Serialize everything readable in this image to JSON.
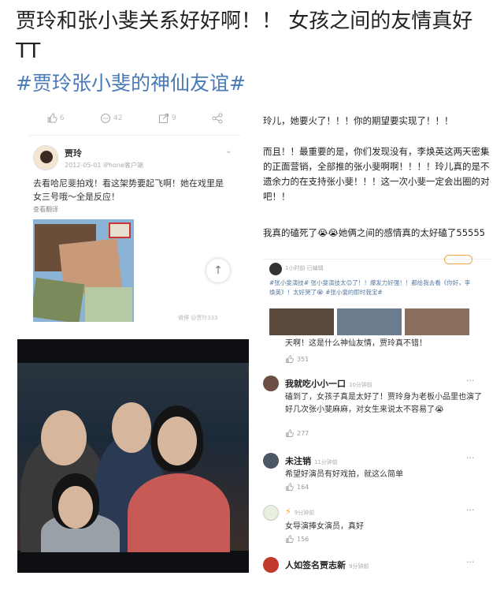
{
  "headline": "贾玲和张小斐关系好好啊！！ 女孩之间的友情真好TT",
  "hashtag": "#贾玲张小斐的神仙友谊#",
  "post": {
    "actions": [
      {
        "icon": "like-icon",
        "count": "6"
      },
      {
        "icon": "comment-icon",
        "count": "42"
      },
      {
        "icon": "share-icon",
        "count": "9"
      },
      {
        "icon": "link-icon",
        "count": ""
      }
    ],
    "author": "贾玲",
    "meta": "2012-05-01 iPhone客户端",
    "text": "去看哈尼斐拍戏！看这架势要起飞啊！她在戏里是女三号哦～全是反应！",
    "translate": "查看翻译",
    "watermark": "微博 @贾玲333"
  },
  "right": {
    "line1": "玲儿，她要火了！！！你的期望要实现了！！！",
    "para2": "而且！！最重要的是，你们发现没有，李焕英这两天密集的正面营销，全部推的张小斐啊啊！！！！玲儿真的是不遗余力的在支持张小斐！！！这一次小斐一定会出圈的对吧！！",
    "para3": "我真的磕死了😭😭她俩之间的感情真的太好磕了55555"
  },
  "mini_card": {
    "meta": "1小时前  已编辑",
    "text": "#张小斐演技# 张小斐演技太😊了！！爆发力好强！！都给我去看《你好，李焕英》！太好哭了😭 #张小斐的即时我宝#"
  },
  "comments": [
    {
      "name": "",
      "time": "",
      "text": "天啊！这是什么神仙友情，贾玲真不错！",
      "likes": "351"
    },
    {
      "name": "我就吃小小一口",
      "time": "10分钟前",
      "text": "磕到了，女孩子真是太好了！贾玲身为老板小品里也演了好几次张小斐麻麻，对女生来说太不容易了😭",
      "likes": "277"
    },
    {
      "name": "未注销",
      "time": "11分钟前",
      "text": "希望好演员有好戏拍，就这么简单",
      "likes": "164"
    },
    {
      "name": "",
      "time": "9分钟前",
      "text": "女导演捧女演员，真好",
      "likes": "156"
    },
    {
      "name": "人如签名贾志新",
      "time": "9分钟前",
      "text": "",
      "likes": ""
    }
  ],
  "colors": {
    "hashtag": "#4a7ab8",
    "link": "#5678a0"
  }
}
